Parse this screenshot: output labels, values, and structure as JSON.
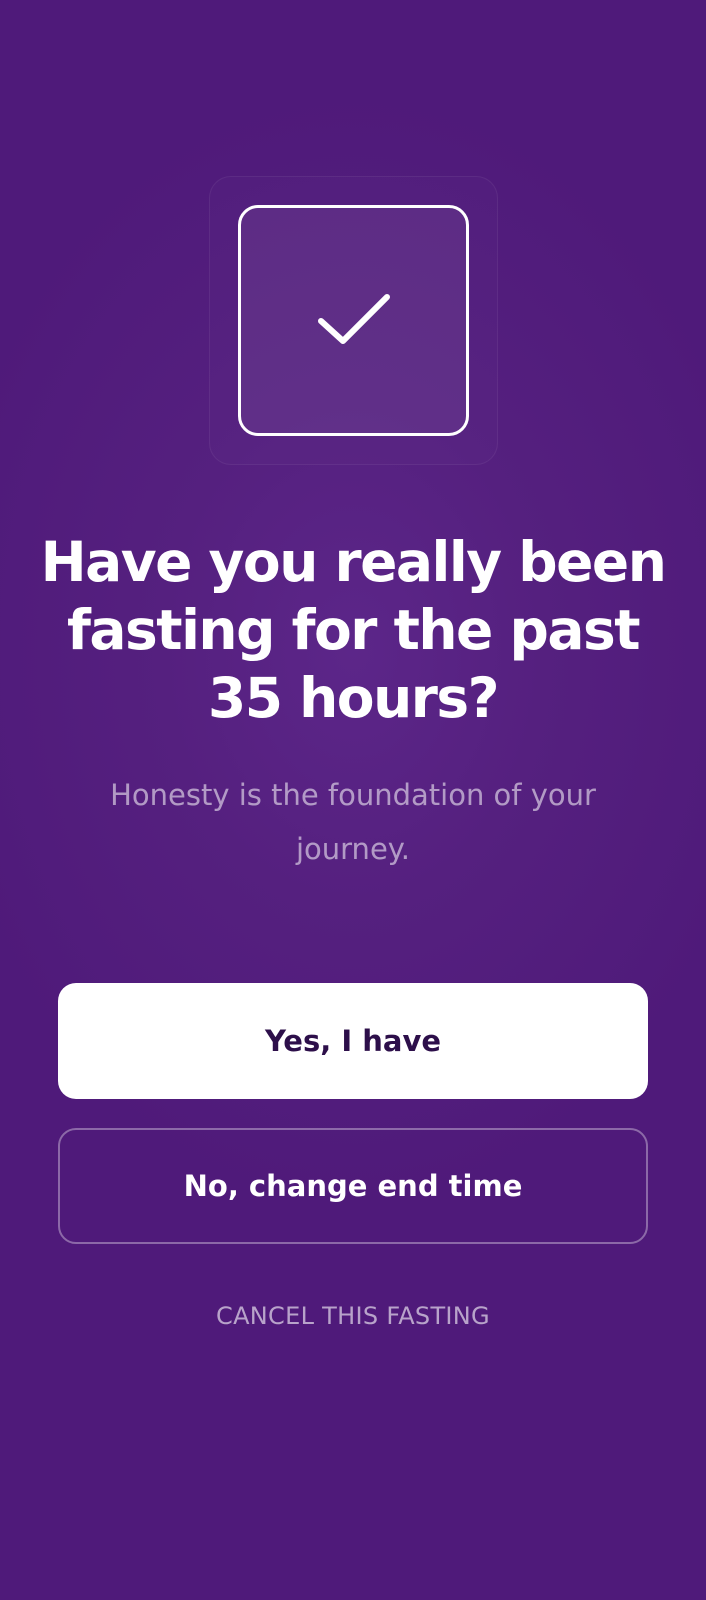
{
  "icon": {
    "name": "checkmark-icon",
    "color": "#ffffff"
  },
  "dialog": {
    "title": "Have you really been fasting for the past 35 hours?",
    "subtitle": "Honesty is the foundation of your journey."
  },
  "actions": {
    "confirm_label": "Yes, I have",
    "change_label": "No, change end time",
    "cancel_label": "CANCEL THIS FASTING"
  },
  "colors": {
    "background": "#4f1a7a",
    "primary_button_bg": "#ffffff",
    "primary_button_text": "#2d0f4a"
  }
}
